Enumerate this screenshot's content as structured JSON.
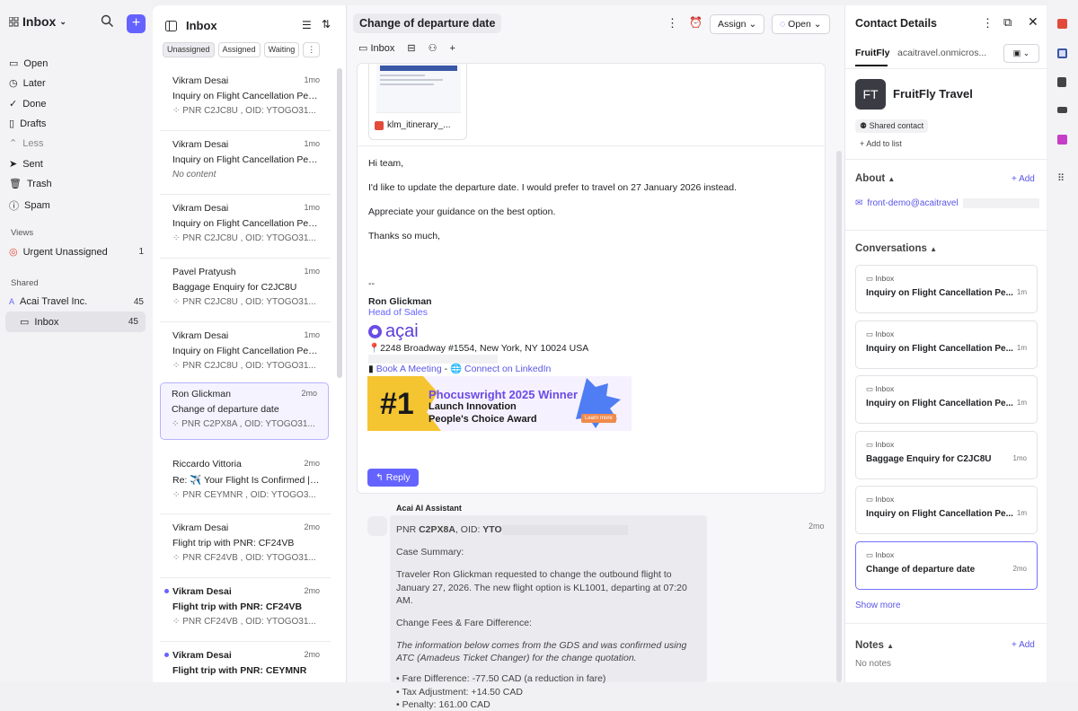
{
  "sidebar": {
    "title": "Inbox",
    "nav": [
      {
        "label": "Open",
        "icon": "inbox-icon"
      },
      {
        "label": "Later",
        "icon": "clock-icon"
      },
      {
        "label": "Done",
        "icon": "check-circle-icon"
      },
      {
        "label": "Drafts",
        "icon": "file-icon"
      },
      {
        "label": "Less",
        "icon": "chevron-up-icon"
      },
      {
        "label": "Sent",
        "icon": "send-icon"
      },
      {
        "label": "Trash",
        "icon": "trash-icon"
      },
      {
        "label": "Spam",
        "icon": "alert-icon"
      }
    ],
    "views_label": "Views",
    "views": [
      {
        "label": "Urgent Unassigned",
        "count": "1"
      }
    ],
    "shared_label": "Shared",
    "shared": [
      {
        "label": "Acai Travel Inc.",
        "count": "45"
      },
      {
        "label": "Inbox",
        "count": "45"
      }
    ]
  },
  "list": {
    "title": "Inbox",
    "filters": [
      "Unassigned",
      "Assigned",
      "Waiting",
      "⋮"
    ],
    "items": [
      {
        "from": "Vikram Desai",
        "time": "1mo",
        "subject": "Inquiry on Flight Cancellation Pen...",
        "meta": "PNR C2JC8U , OID: YTOGO31..."
      },
      {
        "from": "Vikram Desai",
        "time": "1mo",
        "subject": "Inquiry on Flight Cancellation Pen...",
        "meta": "No content"
      },
      {
        "from": "Vikram Desai",
        "time": "1mo",
        "subject": "Inquiry on Flight Cancellation Pen...",
        "meta": "PNR C2JC8U , OID: YTOGO31..."
      },
      {
        "from": "Pavel Pratyush",
        "time": "1mo",
        "subject": "Baggage Enquiry for C2JC8U",
        "meta": "PNR C2JC8U , OID: YTOGO31..."
      },
      {
        "from": "Vikram Desai",
        "time": "1mo",
        "subject": "Inquiry on Flight Cancellation Pen...",
        "meta": "PNR C2JC8U , OID: YTOGO31..."
      },
      {
        "from": "Ron Glickman",
        "time": "2mo",
        "subject": "Change of departure date",
        "meta": "PNR C2PX8A , OID: YTOGO31..."
      },
      {
        "from": "Riccardo Vittoria",
        "time": "2mo",
        "subject": "Re: ✈️ Your Flight Is Confirmed | ...",
        "meta": "PNR CEYMNR , OID: YTOGO3..."
      },
      {
        "from": "Vikram Desai",
        "time": "2mo",
        "subject": "Flight trip with PNR: CF24VB",
        "meta": "PNR CF24VB , OID: YTOGO31..."
      },
      {
        "from": "Vikram Desai",
        "time": "2mo",
        "subject": "Flight trip with PNR: CF24VB",
        "meta": "PNR CF24VB , OID: YTOGO31..."
      },
      {
        "from": "Vikram Desai",
        "time": "2mo",
        "subject": "Flight trip with PNR: CEYMNR",
        "meta": ""
      }
    ]
  },
  "conversation": {
    "title": "Change of departure date",
    "assign_label": "Assign",
    "status_label": "Open",
    "tab_inbox": "Inbox",
    "attachment_name": "klm_itinerary_...",
    "body": [
      "Hi team,",
      "I'd like to update the departure date. I would prefer to travel on 27 January 2026 instead.",
      "Appreciate your guidance on the best option.",
      "Thanks so much,"
    ],
    "signature": {
      "dashes": "--",
      "name": "Ron Glickman",
      "role": "Head of Sales",
      "logo": "açai",
      "address": "2248 Broadway #1554, New York, NY 10024 USA",
      "meeting": "Book A Meeting",
      "dash": " - ",
      "linkedin": "Connect on LinkedIn"
    },
    "banner": {
      "rank": "#1",
      "line1": "Phocuswright 2025 Winner",
      "line2": "Launch Innovation",
      "line3": "People's Choice Award",
      "cta": "Learn more"
    },
    "reply_label": "Reply",
    "ai": {
      "name": "Acai AI Assistant",
      "time": "2mo",
      "pnr_prefix": "PNR ",
      "pnr": "C2PX8A",
      "oid_prefix": ", OID: ",
      "oid": "YTO",
      "case_summary": "Case Summary:",
      "summary": "Traveler Ron Glickman requested to change the outbound flight to January 27, 2026. The new flight option is KL1001, departing at 07:20 AM.",
      "fees_title": "Change Fees & Fare Difference:",
      "note": "The information below comes from the GDS and was confirmed using ATC (Amadeus Ticket Changer) for the change quotation.",
      "bullets": [
        "Fare Difference: -77.50 CAD (a reduction in fare)",
        "Tax Adjustment: +14.50 CAD",
        "Penalty: 161.00 CAD"
      ]
    }
  },
  "contact": {
    "title": "Contact Details",
    "tab_company": "FruitFly",
    "tab_domain": "acaitravel.onmicros...",
    "initials": "FT",
    "company": "FruitFly Travel",
    "shared": "Shared contact",
    "add_to_list": "+ Add to list",
    "about_label": "About",
    "add_label": "+ Add",
    "email": "front-demo@acaitravel",
    "conversations_label": "Conversations",
    "conversations": [
      {
        "inbox": "Inbox",
        "title": "Inquiry on Flight Cancellation Pe...",
        "time": "1mo"
      },
      {
        "inbox": "Inbox",
        "title": "Inquiry on Flight Cancellation Pe...",
        "time": "1mo"
      },
      {
        "inbox": "Inbox",
        "title": "Inquiry on Flight Cancellation Pe...",
        "time": "1mo"
      },
      {
        "inbox": "Inbox",
        "title": "Baggage Enquiry for C2JC8U",
        "time": "1mo"
      },
      {
        "inbox": "Inbox",
        "title": "Inquiry on Flight Cancellation Pe...",
        "time": "1mo"
      },
      {
        "inbox": "Inbox",
        "title": "Change of departure date",
        "time": "2mo"
      }
    ],
    "show_more": "Show more",
    "notes_label": "Notes",
    "no_notes": "No notes"
  },
  "colors": {
    "accent": "#6563ff",
    "link": "#5a55e6",
    "banner_yellow": "#f5c431"
  }
}
